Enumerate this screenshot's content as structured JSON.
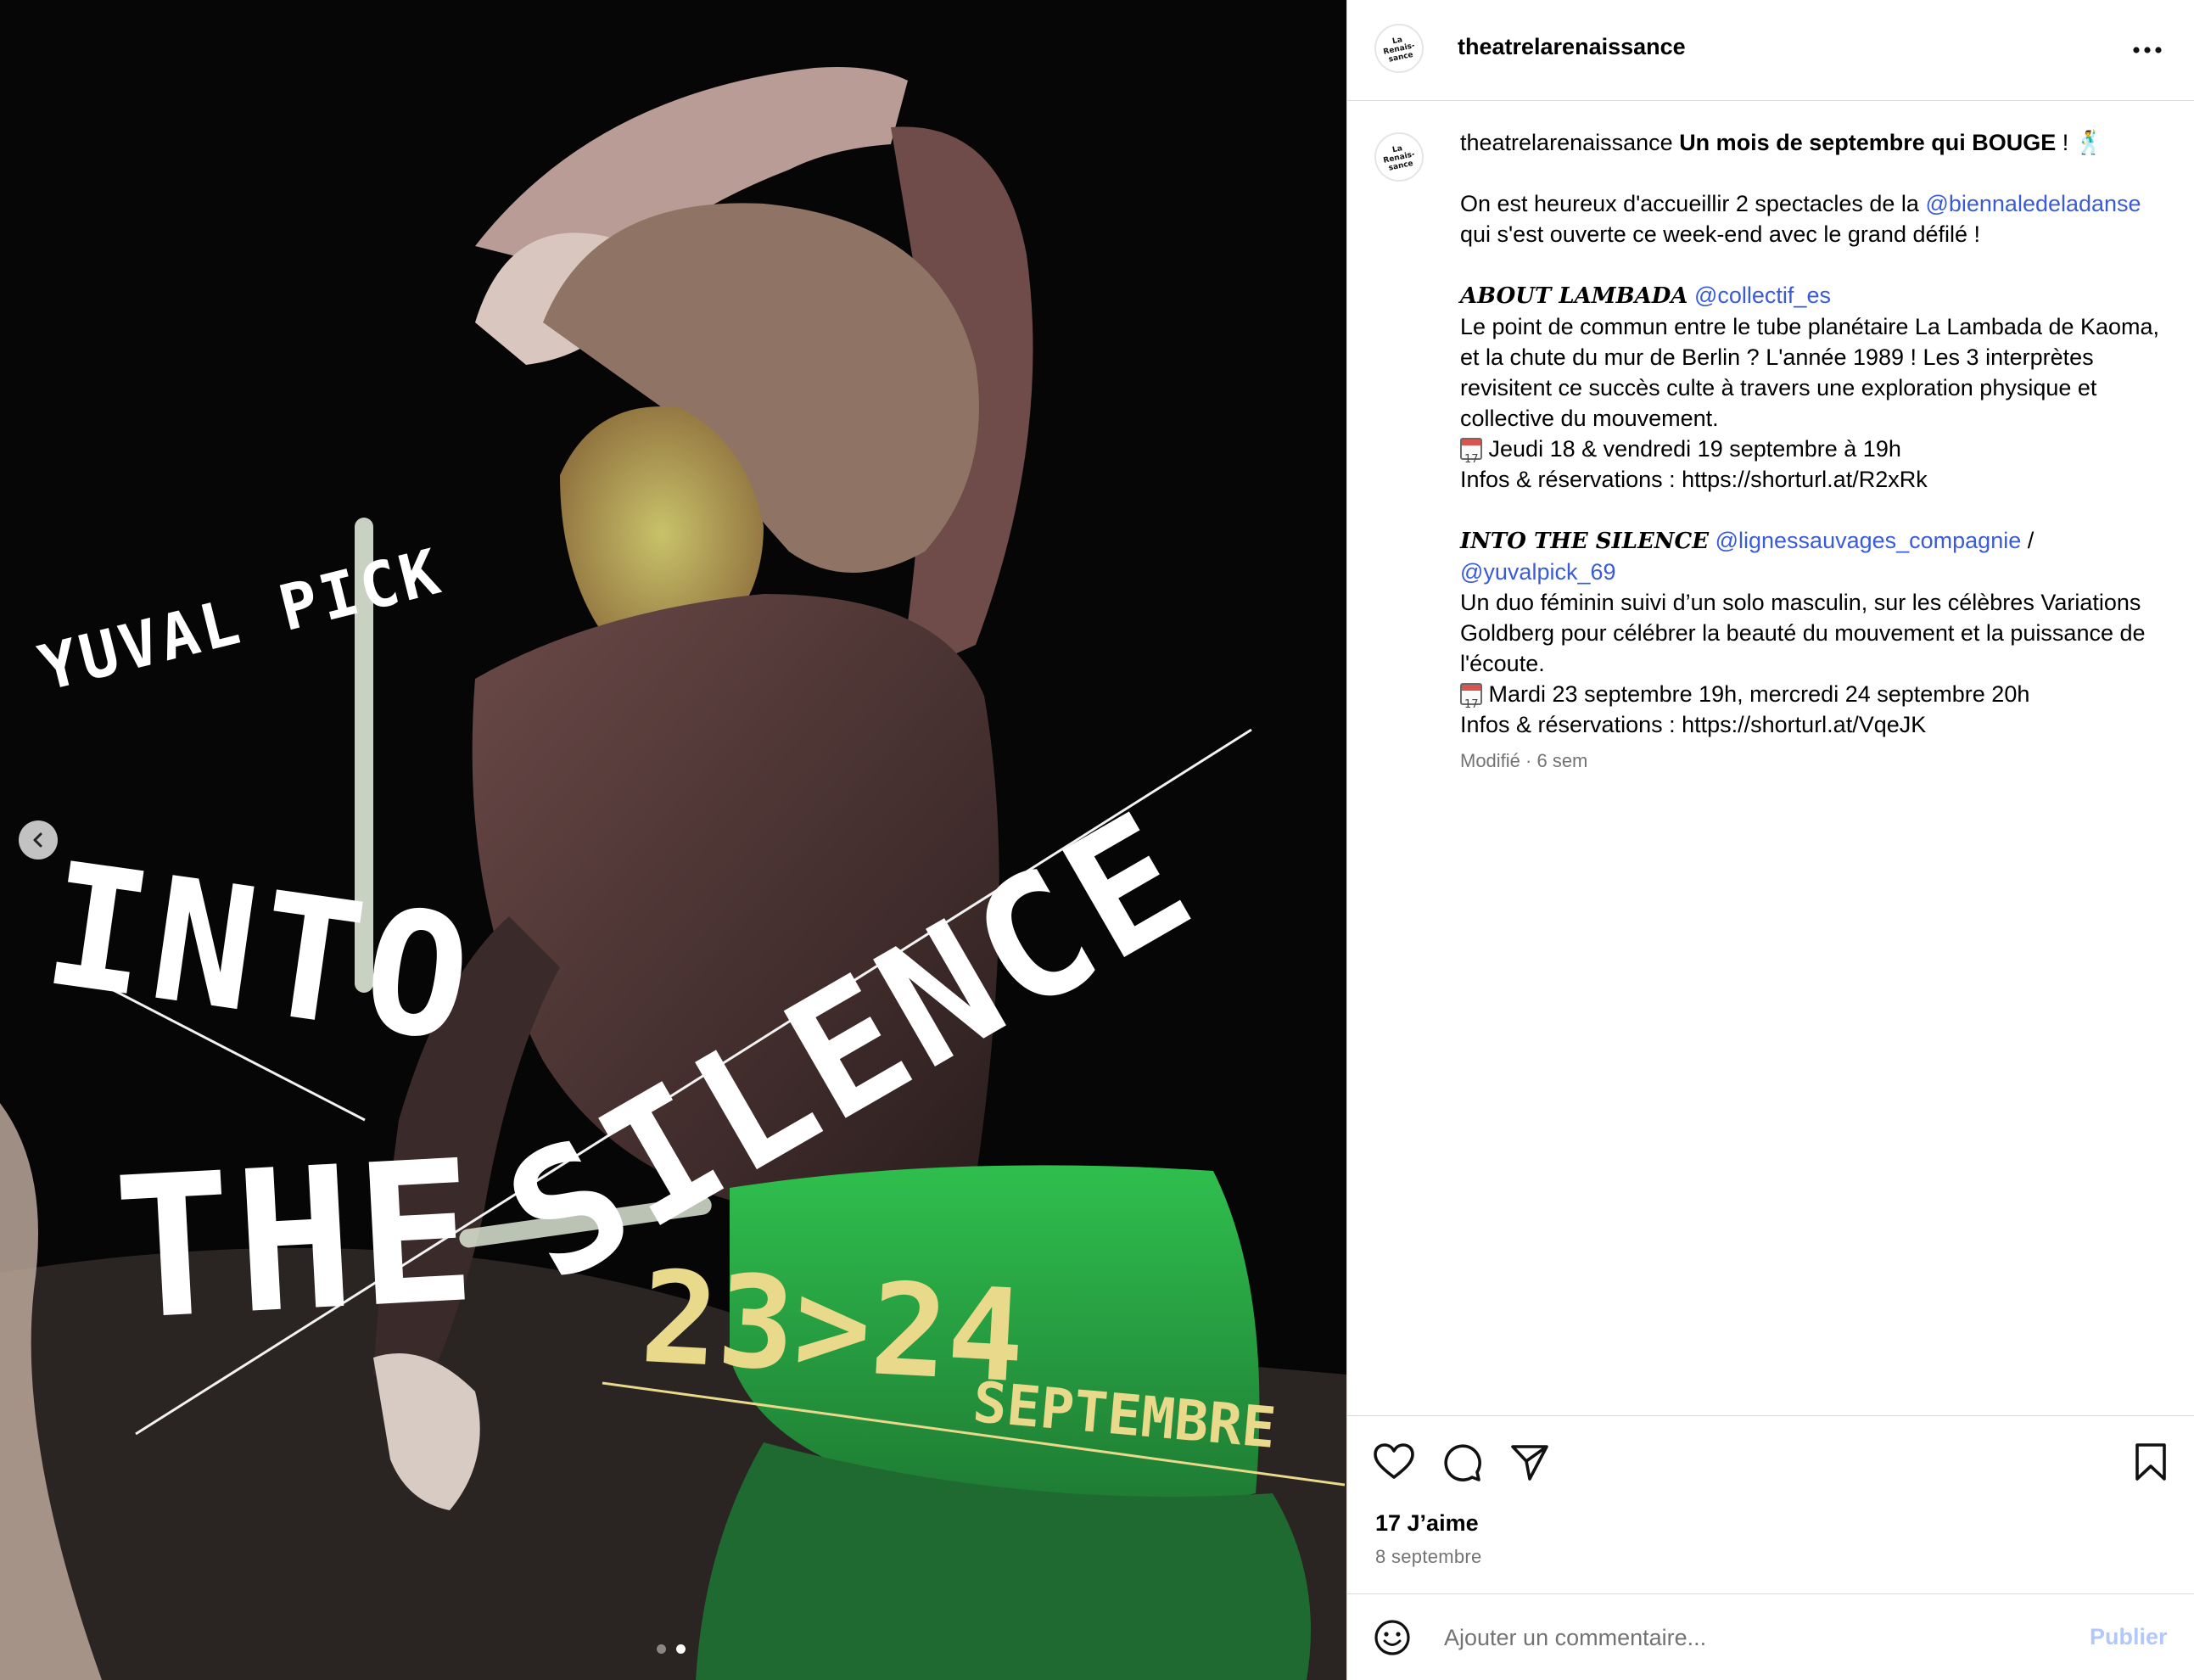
{
  "poster": {
    "artist": "YUVAL PICK",
    "title_line1": "INTO",
    "title_line2": "THE",
    "title_line3": "SILENCE",
    "dates": "23>24",
    "month": "SEPTEMBRE",
    "carousel_total": 2,
    "carousel_active": 2
  },
  "header": {
    "username": "theatrelarenaissance",
    "avatar_text": "La Renais-sance"
  },
  "caption": {
    "username": "theatrelarenaissance",
    "headline": "Un mois de septembre qui BOUGE",
    "headline_suffix": " ! 🕺",
    "p1_a": "On est heureux d'accueillir 2 spectacles de la ",
    "p1_mention": "@biennaledeladanse",
    "p1_b": " qui s'est ouverte ce week-end avec le grand défilé !",
    "show1_title": "ABOUT LAMBADA",
    "show1_mention": "@collectif_es",
    "show1_desc": "Le point de commun entre le tube planétaire La Lambada de Kaoma, et la chute du mur de Berlin ? L'année 1989 ! Les 3 interprètes revisitent ce succès culte à travers une exploration physique et collective du mouvement.",
    "show1_dates": "Jeudi 18 & vendredi 19 septembre à 19h",
    "show1_info": "Infos & réservations : https://shorturl.at/R2xRk",
    "show2_title": "INTO THE SILENCE",
    "show2_mention1": "@lignessauvages_compagnie",
    "show2_sep": " / ",
    "show2_mention2": "@yuvalpick_69",
    "show2_desc": "Un duo féminin suivi d’un solo masculin, sur les célèbres Variations Goldberg pour célébrer la beauté du mouvement et la puissance de l'écoute.",
    "show2_dates": "Mardi 23 septembre 19h, mercredi 24 septembre 20h",
    "show2_info": "Infos & réservations : https://shorturl.at/VqeJK",
    "meta": "Modifié · 6 sem"
  },
  "stats": {
    "likes": "17 J’aime",
    "date": "8 septembre"
  },
  "comment": {
    "placeholder": "Ajouter un commentaire...",
    "publish": "Publier"
  },
  "colors": {
    "mention": "#3a5bd9",
    "publish_disabled": "#b3c7f9",
    "poster_text": "#ffffff",
    "poster_dates": "#e9d98a",
    "poster_green": "#2ea84a"
  },
  "icons": [
    "chevron-left-icon",
    "more-icon",
    "heart-icon",
    "comment-icon",
    "share-icon",
    "bookmark-icon",
    "emoji-icon",
    "calendar-icon"
  ]
}
